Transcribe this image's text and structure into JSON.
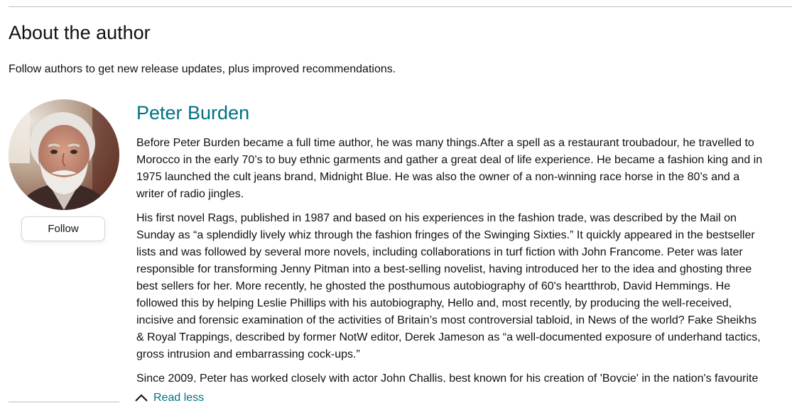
{
  "section": {
    "title": "About the author",
    "subtitle": "Follow authors to get new release updates, plus improved recommendations."
  },
  "author": {
    "name": "Peter Burden",
    "follow_label": "Follow",
    "avatar_icon": "author-photo"
  },
  "bio": {
    "paragraph_1": [
      "Before Peter Burden became a full time author, he was many things.After a spell as a restaurant troubadour, he travelled to",
      "Morocco in the early 70’s to buy ethnic garments and gather a great deal of life experience. He became a fashion king and in",
      "1975 launched the cult jeans brand, Midnight Blue. He was also the owner of a non-winning race horse in the 80’s and a",
      "writer of radio jingles."
    ],
    "paragraph_2": [
      "His first novel Rags, published in 1987 and based on his experiences in the fashion trade, was described by the Mail on",
      "Sunday as “a splendidly lively whiz through the fashion fringes of the Swinging Sixties.” It quickly appeared in the bestseller",
      "lists and was followed by several more novels, including collaborations in turf fiction with John Francome. Peter was later",
      "responsible for transforming Jenny Pitman into a best-selling novelist, having introduced her to the idea and ghosting three",
      "best sellers for her. More recently, he ghosted the posthumous autobiography of 60's heartthrob, David Hemmings. He",
      "followed this by helping Leslie Phillips with his autobiography, Hello and, most recently, by producing the well-received,",
      "incisive and forensic examination of the activities of Britain’s most controversial tabloid, in News of the world? Fake Sheikhs",
      "& Royal Trappings, described by former NotW editor, Derek Jameson as “a well-documented exposure of underhand tactics,",
      "gross intrusion and embarrassing cock-ups.”"
    ],
    "paragraph_3": [
      "Since 2009, Peter has worked closely with actor John Challis, best known for his creation of 'Boycie' in the nation's favourite"
    ],
    "read_less_label": "Read less",
    "read_less_icon": "chevron-up-icon"
  }
}
